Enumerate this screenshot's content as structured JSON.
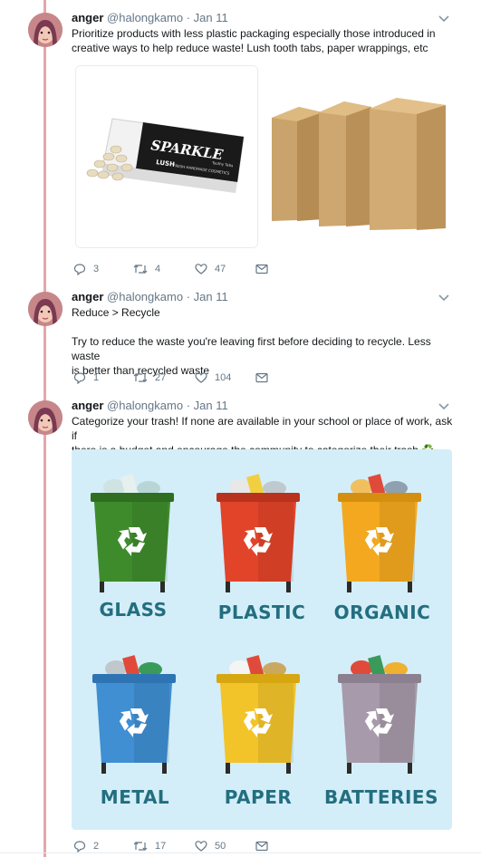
{
  "tweets": [
    {
      "name": "anger",
      "handle": "@halongkamo",
      "time": "· Jan 11",
      "lines": [
        "Prioritize products with less plastic packaging especially those introduced in",
        "creative ways to help reduce waste! Lush tooth tabs, paper wrappings, etc"
      ],
      "replies": "3",
      "retweets": "4",
      "likes": "47",
      "media": {
        "box_brand": "LUSH",
        "box_product": "SPARKLE",
        "box_subtitle": "FRESH HANDMADE COSMETICS",
        "box_tag": "Toothy Tabs"
      }
    },
    {
      "name": "anger",
      "handle": "@halongkamo",
      "time": "· Jan 11",
      "line_a": "Reduce > Recycle",
      "lines": [
        "Try to reduce the waste you're leaving first before deciding to recycle. Less waste",
        "is better than recycled waste"
      ],
      "replies": "1",
      "retweets": "27",
      "likes": "104"
    },
    {
      "name": "anger",
      "handle": "@halongkamo",
      "time": "· Jan 11",
      "lines": [
        "Categorize your trash! If none are available in your school or place of work, ask if",
        "there is a budget and encourage the community to categorize their trash ♻️"
      ],
      "replies": "2",
      "retweets": "17",
      "likes": "50",
      "bins": [
        {
          "label": "GLASS",
          "color": "#3e8b2c",
          "lid": "#2f6e20"
        },
        {
          "label": "PLASTIC",
          "color": "#e2442a",
          "lid": "#b9321d"
        },
        {
          "label": "ORGANIC",
          "color": "#f3a81f",
          "lid": "#d58f10"
        },
        {
          "label": "METAL",
          "color": "#3f8fd2",
          "lid": "#2e74b3"
        },
        {
          "label": "PAPER",
          "color": "#f2c42a",
          "lid": "#d6a713"
        },
        {
          "label": "BATTERIES",
          "color": "#a79aaa",
          "lid": "#8c7f90"
        }
      ]
    }
  ],
  "colors": {
    "thread_line": "#e8a5a8",
    "muted": "#657786",
    "label_teal": "#236e7f"
  },
  "icons": [
    "reply-icon",
    "retweet-icon",
    "like-icon",
    "message-icon",
    "chevron-down-icon",
    "recycle-icon"
  ]
}
